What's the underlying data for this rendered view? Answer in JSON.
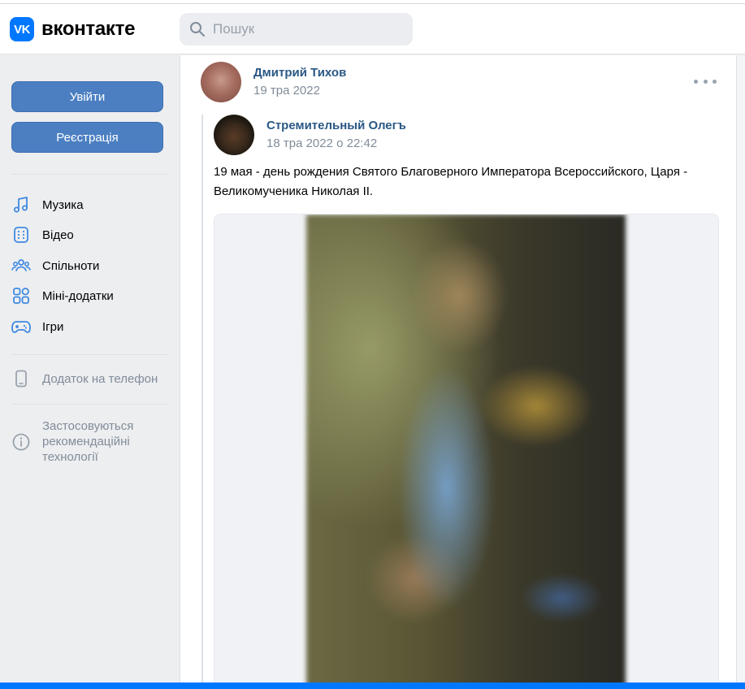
{
  "header": {
    "logo_mark": "VK",
    "logo_text": "вконтакте",
    "search_placeholder": "Пошук",
    "search_icon": "search-icon"
  },
  "sidebar": {
    "login_label": "Увійти",
    "register_label": "Реєстрація",
    "nav": [
      {
        "label": "Музика",
        "icon": "music-note-icon"
      },
      {
        "label": "Відео",
        "icon": "video-icon"
      },
      {
        "label": "Спільноти",
        "icon": "communities-icon"
      },
      {
        "label": "Міні-додатки",
        "icon": "mini-apps-icon"
      },
      {
        "label": "Ігри",
        "icon": "gamepad-icon"
      }
    ],
    "mobile_app_label": "Додаток на телефон",
    "mobile_app_icon": "phone-icon",
    "recommendations_label": "Застосовуються рекомендаційні технології",
    "recommendations_icon": "info-icon"
  },
  "post": {
    "author_name": "Дмитрий Тихов",
    "date": "19 тра 2022",
    "more_icon": "more-icon",
    "repost": {
      "author_name": "Стремительный Олегъ",
      "date": "18 тра 2022 о 22:42",
      "text": "19 мая - день рождения Святого Благоверного Императора Всероссийского, Царя - Великомученика Николая II."
    }
  },
  "colors": {
    "accent": "#0077ff",
    "button": "#4b7fc2",
    "link": "#2a5885",
    "muted": "#818c99",
    "background": "#edeef0"
  }
}
